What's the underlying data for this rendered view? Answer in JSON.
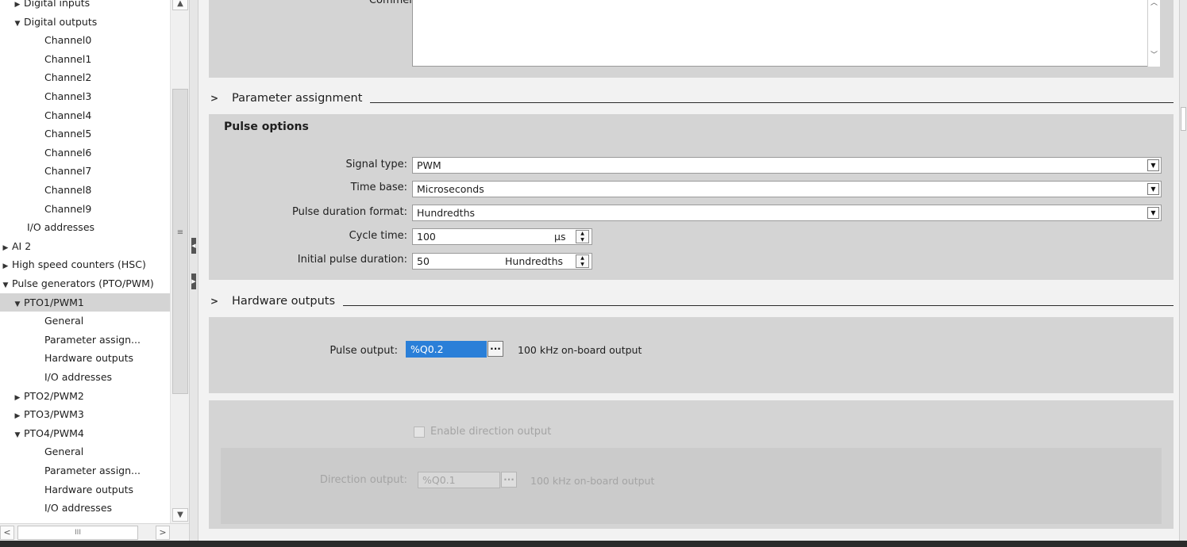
{
  "tree": {
    "items": [
      {
        "label": "Digital inputs",
        "level": 1,
        "arrow": "▶"
      },
      {
        "label": "Digital outputs",
        "level": 1,
        "arrow": "▼"
      },
      {
        "label": "Channel0",
        "level": 2
      },
      {
        "label": "Channel1",
        "level": 2
      },
      {
        "label": "Channel2",
        "level": 2
      },
      {
        "label": "Channel3",
        "level": 2
      },
      {
        "label": "Channel4",
        "level": 2
      },
      {
        "label": "Channel5",
        "level": 2
      },
      {
        "label": "Channel6",
        "level": 2
      },
      {
        "label": "Channel7",
        "level": 2
      },
      {
        "label": "Channel8",
        "level": 2
      },
      {
        "label": "Channel9",
        "level": 2
      },
      {
        "label": "I/O addresses",
        "level": 1
      },
      {
        "label": "AI 2",
        "level": 0,
        "arrow": "▶"
      },
      {
        "label": "High speed counters (HSC)",
        "level": 0,
        "arrow": "▶"
      },
      {
        "label": "Pulse generators (PTO/PWM)",
        "level": 0,
        "arrow": "▼"
      },
      {
        "label": "PTO1/PWM1",
        "level": 1,
        "arrow": "▼",
        "selected": true
      },
      {
        "label": "General",
        "level": 2
      },
      {
        "label": "Parameter assign...",
        "level": 2
      },
      {
        "label": "Hardware outputs",
        "level": 2
      },
      {
        "label": "I/O addresses",
        "level": 2
      },
      {
        "label": "PTO2/PWM2",
        "level": 1,
        "arrow": "▶"
      },
      {
        "label": "PTO3/PWM3",
        "level": 1,
        "arrow": "▶"
      },
      {
        "label": "PTO4/PWM4",
        "level": 1,
        "arrow": "▼"
      },
      {
        "label": "General",
        "level": 2
      },
      {
        "label": "Parameter assign...",
        "level": 2
      },
      {
        "label": "Hardware outputs",
        "level": 2
      },
      {
        "label": "I/O addresses",
        "level": 2
      }
    ],
    "scroll_up_icon": "▲",
    "scroll_down_icon": "▼",
    "scroll_left_icon": "<",
    "scroll_right_icon": ">",
    "hthumb_grip": "III",
    "vthumb_grip": "≡"
  },
  "splitter": {
    "collapse_left_icon": "◀",
    "collapse_right_icon": "▶"
  },
  "general": {
    "comment_label": "Comment:",
    "comment_value": ""
  },
  "parameter_assignment": {
    "section_title": "Parameter assignment",
    "chevron": ">",
    "group_title": "Pulse options",
    "signal_type_label": "Signal type:",
    "signal_type_value": "PWM",
    "time_base_label": "Time base:",
    "time_base_value": "Microseconds",
    "pulse_duration_format_label": "Pulse duration format:",
    "pulse_duration_format_value": "Hundredths",
    "cycle_time_label": "Cycle time:",
    "cycle_time_value": "100",
    "cycle_time_unit": "µs",
    "initial_pulse_label": "Initial pulse duration:",
    "initial_pulse_value": "50",
    "initial_pulse_unit": "Hundredths",
    "dropdown_icon": "▼",
    "spin_up": "▲",
    "spin_down": "▼"
  },
  "hardware_outputs": {
    "section_title": "Hardware outputs",
    "chevron": ">",
    "pulse_output_label": "Pulse output:",
    "pulse_output_value": "%Q0.2",
    "pulse_output_note": "100 kHz on-board output",
    "browse_label": "...",
    "enable_direction_label": "Enable direction output",
    "enable_direction_checked": false,
    "direction_output_label": "Direction output:",
    "direction_output_value": "%Q0.1",
    "direction_output_note": "100 kHz on-board output"
  },
  "colors": {
    "panel_gray": "#d4d4d4",
    "selection_blue": "#2a7fd8",
    "background": "#f2f2f2"
  }
}
